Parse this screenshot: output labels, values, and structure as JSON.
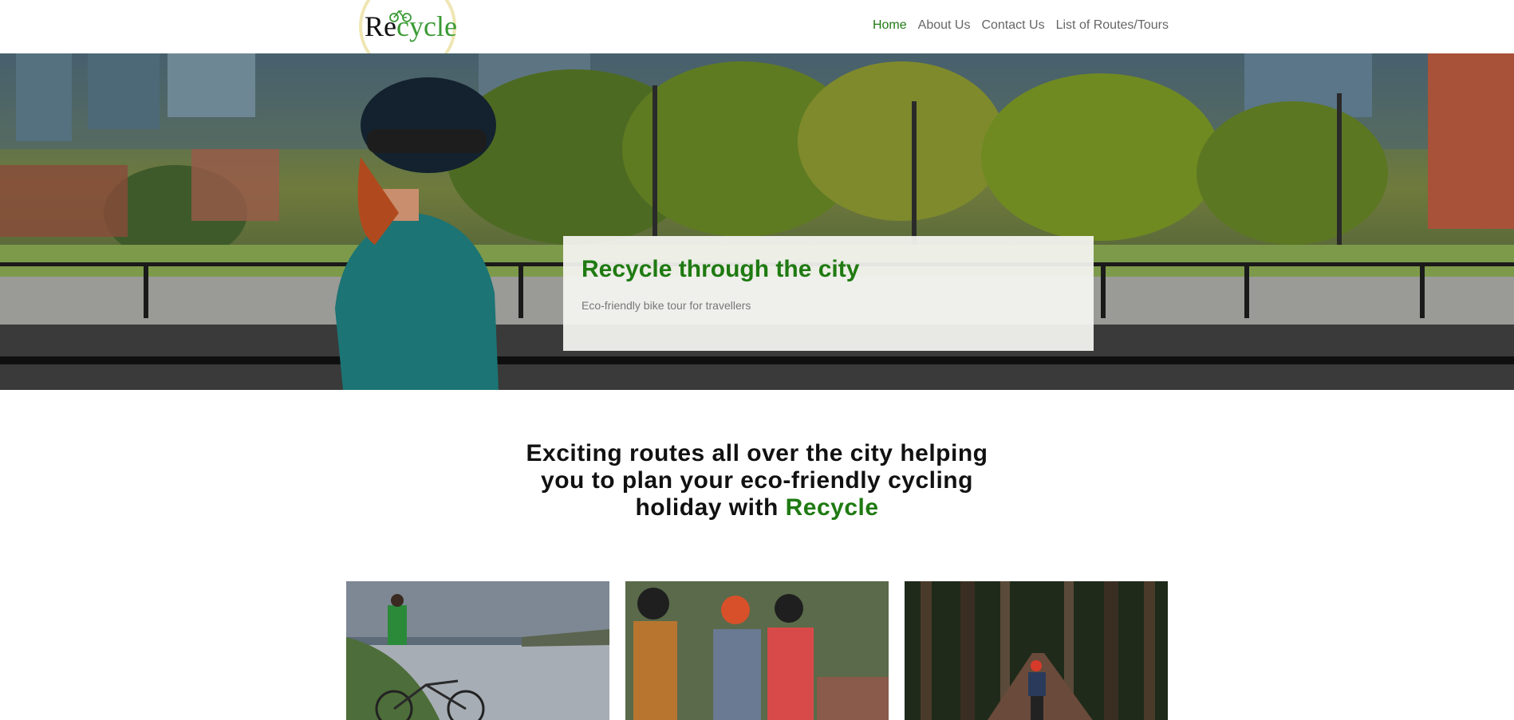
{
  "logo": {
    "prefix": "Re",
    "suffix": "cycle"
  },
  "nav": {
    "items": [
      {
        "label": "Home",
        "active": true
      },
      {
        "label": "About Us",
        "active": false
      },
      {
        "label": "Contact Us",
        "active": false
      },
      {
        "label": "List of Routes/Tours",
        "active": false
      }
    ]
  },
  "hero": {
    "title": "Recycle through the city",
    "subtitle": "Eco-friendly bike tour for travellers"
  },
  "intro": {
    "text": "Exciting routes all over the city helping you to plan your eco-friendly cycling holiday with",
    "brand": "Recycle"
  },
  "colors": {
    "accent": "#1f7a12",
    "logo_green": "#3a9a34",
    "nav_text": "#666666"
  }
}
